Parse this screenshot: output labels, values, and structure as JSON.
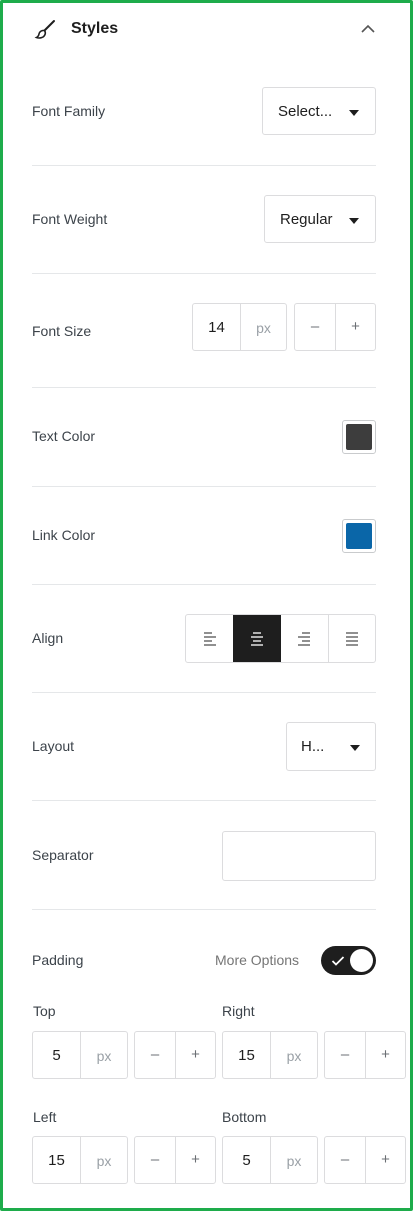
{
  "panel": {
    "title": "Styles"
  },
  "font_family": {
    "label": "Font Family",
    "value": "Select..."
  },
  "font_weight": {
    "label": "Font Weight",
    "value": "Regular"
  },
  "font_size": {
    "label": "Font Size",
    "value": "14",
    "unit": "px",
    "minus": "–",
    "plus": "+"
  },
  "text_color": {
    "label": "Text Color",
    "color": "#3d3d3d"
  },
  "link_color": {
    "label": "Link Color",
    "color": "#0a66a8"
  },
  "align": {
    "label": "Align",
    "selected": "center",
    "options": [
      "left",
      "center",
      "right",
      "justify"
    ]
  },
  "layout": {
    "label": "Layout",
    "value": "H..."
  },
  "separator": {
    "label": "Separator",
    "value": ""
  },
  "padding": {
    "label": "Padding",
    "more_options_label": "More Options",
    "more_options_enabled": true,
    "top": {
      "label": "Top",
      "value": "5",
      "unit": "px"
    },
    "right": {
      "label": "Right",
      "value": "15",
      "unit": "px"
    },
    "left": {
      "label": "Left",
      "value": "15",
      "unit": "px"
    },
    "bottom": {
      "label": "Bottom",
      "value": "5",
      "unit": "px"
    },
    "minus": "–",
    "plus": "+"
  },
  "colors": {
    "border_accent": "#1eac4b",
    "selected_align_bg": "#1e1e1e",
    "toggle_bg": "#1e1e1e"
  }
}
